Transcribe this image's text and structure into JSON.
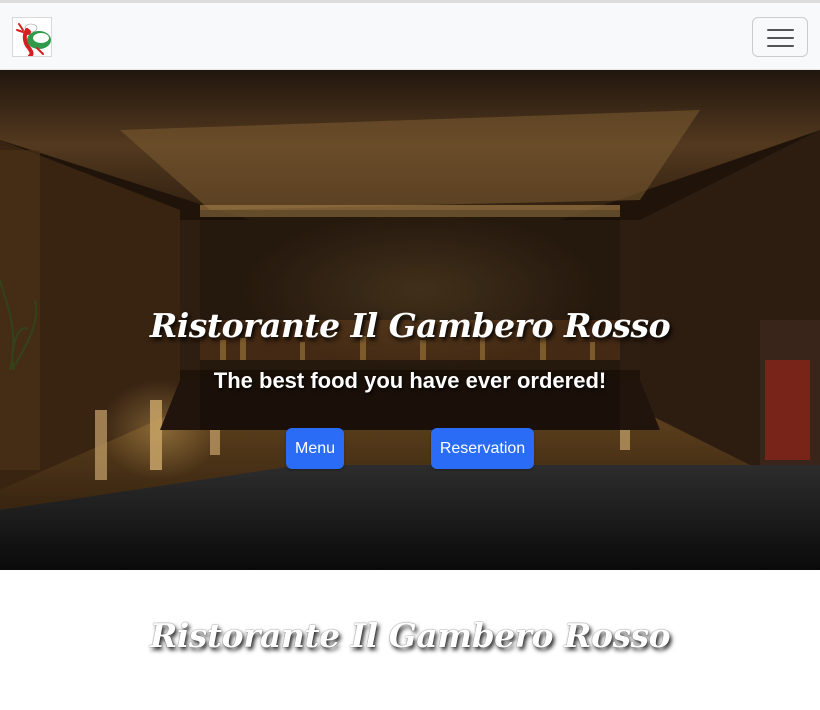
{
  "navbar": {
    "logo_icon": "lobster-chef-logo-icon",
    "toggler_icon": "hamburger-menu-icon"
  },
  "hero": {
    "title": "Ristorante Il Gambero Rosso",
    "subtitle": "The best food you have ever ordered!",
    "menu_button_label": "Menu",
    "reservation_button_label": "Reservation",
    "button_color": "#2a6cf6"
  },
  "section": {
    "title": "Ristorante Il Gambero Rosso"
  }
}
